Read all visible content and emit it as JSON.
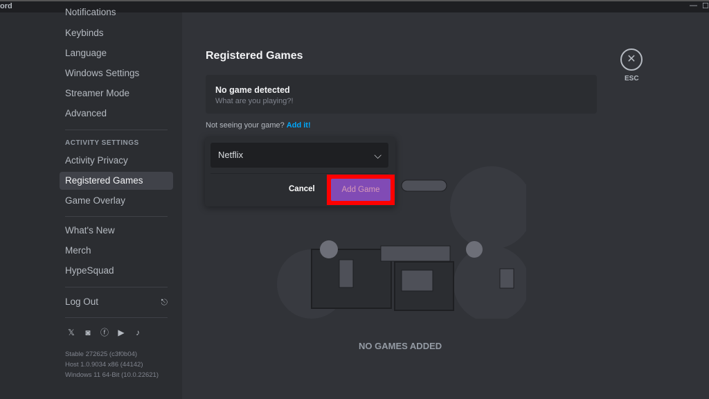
{
  "window": {
    "app_title": "ord",
    "minimize": "—",
    "maximize": "☐"
  },
  "sidebar": {
    "items": [
      {
        "label": "Notifications"
      },
      {
        "label": "Keybinds"
      },
      {
        "label": "Language"
      },
      {
        "label": "Windows Settings"
      },
      {
        "label": "Streamer Mode"
      },
      {
        "label": "Advanced"
      }
    ],
    "activity_section": "ACTIVITY SETTINGS",
    "activity_items": [
      {
        "label": "Activity Privacy"
      },
      {
        "label": "Registered Games",
        "active": true
      },
      {
        "label": "Game Overlay"
      }
    ],
    "misc_items": [
      {
        "label": "What's New"
      },
      {
        "label": "Merch"
      },
      {
        "label": "HypeSquad"
      }
    ],
    "logout": "Log Out",
    "social": [
      "x-icon",
      "instagram-icon",
      "facebook-icon",
      "youtube-icon",
      "tiktok-icon"
    ],
    "version": [
      "Stable 272625 (c3f0b04)",
      "Host 1.0.9034 x86 (44142)",
      "Windows 11 64-Bit (10.0.22621)"
    ]
  },
  "main": {
    "title": "Registered Games",
    "card_title": "No game detected",
    "card_subtitle": "What are you playing?!",
    "hint": "Not seeing your game?",
    "hint_link": "Add it!",
    "select_value": "Netflix",
    "cancel": "Cancel",
    "add_game": "Add Game",
    "empty": "NO GAMES ADDED",
    "esc": "ESC"
  }
}
